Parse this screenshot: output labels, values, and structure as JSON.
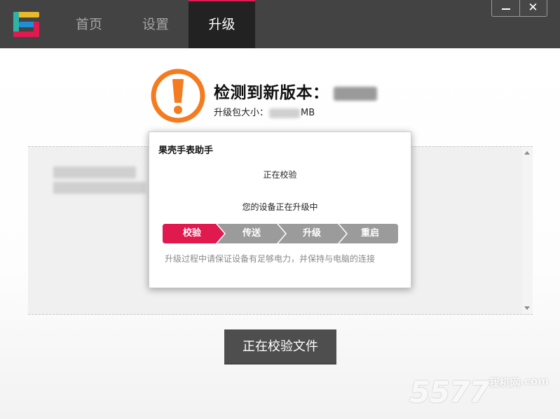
{
  "window": {
    "tabs": [
      {
        "label": "首页"
      },
      {
        "label": "设置"
      },
      {
        "label": "升级"
      }
    ],
    "active_tab": "升级",
    "minimize_label": "—",
    "close_label": "✕"
  },
  "colors": {
    "titlebar": "#434343",
    "active_tab": "#222222",
    "accent_red": "#e0194f",
    "alert_orange": "#f47b20",
    "step_inactive": "#9b9b9b",
    "button": "#4e4e4e"
  },
  "header": {
    "title": "检测到新版本：",
    "size_prefix": "升级包大小：",
    "size_unit": "MB",
    "icon": "alert-icon"
  },
  "dialog": {
    "title": "果壳手表助手",
    "status": "正在校验",
    "description": "您的设备正在升级中",
    "steps": [
      {
        "label": "校验",
        "active": true
      },
      {
        "label": "传送",
        "active": false
      },
      {
        "label": "升级",
        "active": false
      },
      {
        "label": "重启",
        "active": false
      }
    ],
    "tip": "升级过程中请保证设备有足够电力，并保持与电脑的连接"
  },
  "main_button": {
    "label": "正在校验文件"
  },
  "watermark": {
    "text": "5577",
    "sub": "我机网",
    "domain": ".com"
  }
}
